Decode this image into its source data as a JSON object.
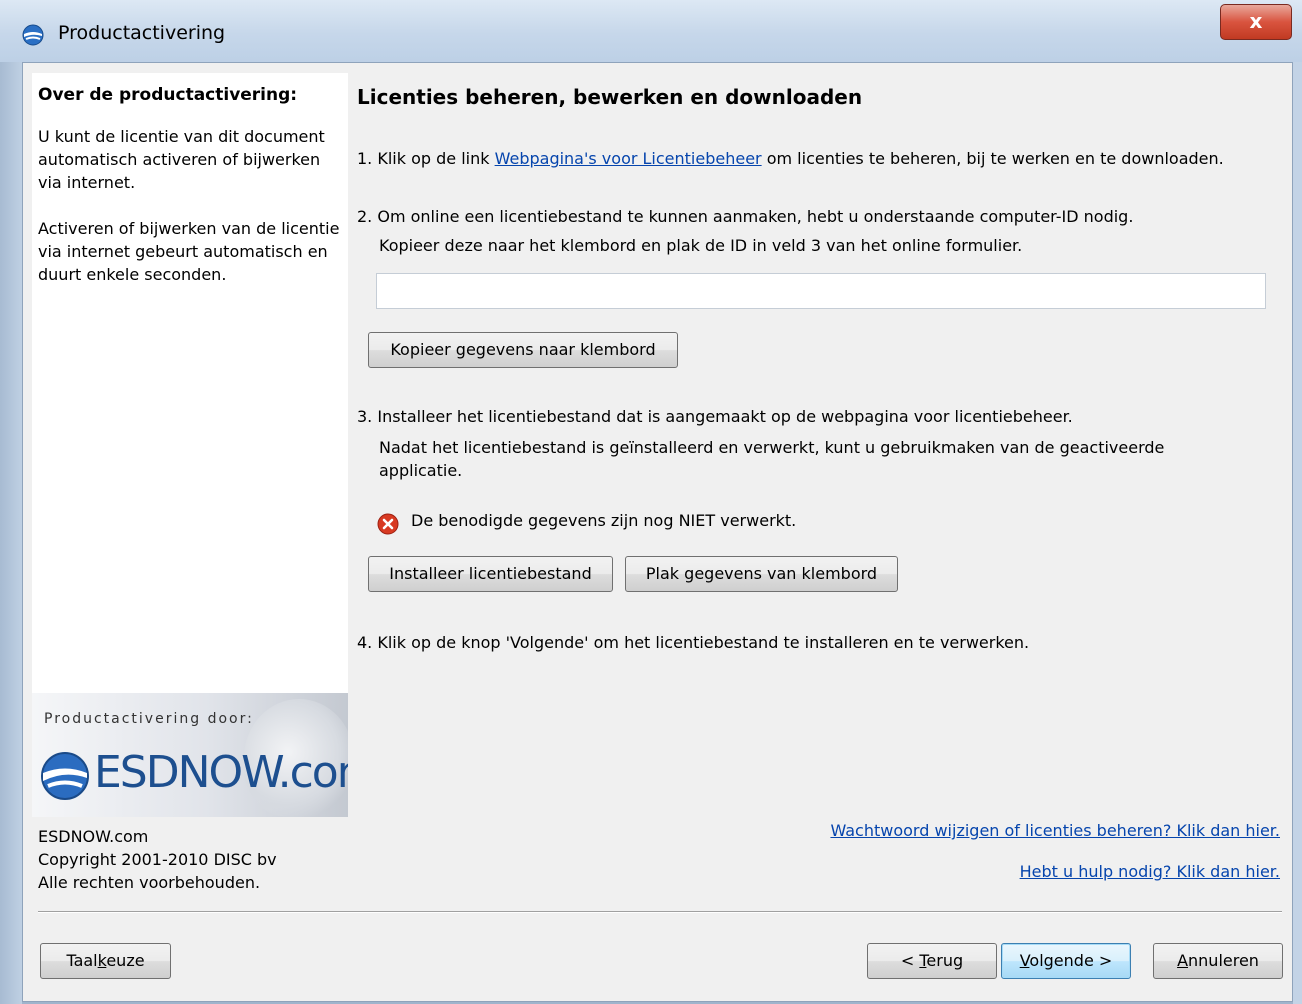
{
  "window": {
    "title": "Productactivering",
    "close_glyph": "x"
  },
  "sidebar": {
    "heading": "Over de productactivering:",
    "paragraph1": "U kunt de licentie van dit document automatisch activeren of bijwerken via internet.",
    "paragraph2": "Activeren of bijwerken van de licentie via internet gebeurt automatisch en duurt enkele seconden.",
    "logo": {
      "caption": "Productactivering door:",
      "wordmark": "ESDNOW.com"
    },
    "copyright": {
      "line1": "ESDNOW.com",
      "line2": "Copyright 2001-2010 DISC bv",
      "line3": "Alle rechten voorbehouden."
    }
  },
  "main": {
    "heading": "Licenties beheren, bewerken en downloaden",
    "step1": {
      "prefix": "1. Klik op de link ",
      "link": "Webpagina's voor Licentiebeheer",
      "suffix": " om licenties te beheren, bij te werken en te downloaden."
    },
    "step2": {
      "line1": "2. Om online een licentiebestand te kunnen aanmaken, hebt u onderstaande computer-ID nodig.",
      "line2": "Kopieer deze naar het klembord en plak de ID in veld 3 van het online formulier.",
      "computer_id_value": "",
      "copy_button": "Kopieer gegevens naar klembord"
    },
    "step3": {
      "line1": "3. Installeer het licentiebestand dat is aangemaakt op de webpagina voor licentiebeheer.",
      "line2": "Nadat het licentiebestand is geïnstalleerd en verwerkt, kunt u gebruikmaken van de geactiveerde",
      "line3": "applicatie.",
      "status": "De benodigde gegevens zijn nog NIET verwerkt.",
      "status_icon": "error-icon",
      "status_color": "#d83a22",
      "install_button": "Installeer licentiebestand",
      "paste_button": "Plak gegevens van klembord"
    },
    "step4": "4. Klik op de knop 'Volgende' om het licentiebestand te installeren en te verwerken.",
    "links": {
      "password": "Wachtwoord wijzigen of licenties beheren? Klik dan hier.",
      "help": "Hebt u hulp nodig? Klik dan hier."
    }
  },
  "footer": {
    "language_button": {
      "before": "Taal",
      "accel": "k",
      "after": "euze"
    },
    "back_button": {
      "before": "< ",
      "accel": "T",
      "after": "erug"
    },
    "next_button": {
      "before": "",
      "accel": "V",
      "after": "olgende >"
    },
    "cancel_button": {
      "before": "",
      "accel": "A",
      "after": "nnuleren"
    }
  }
}
